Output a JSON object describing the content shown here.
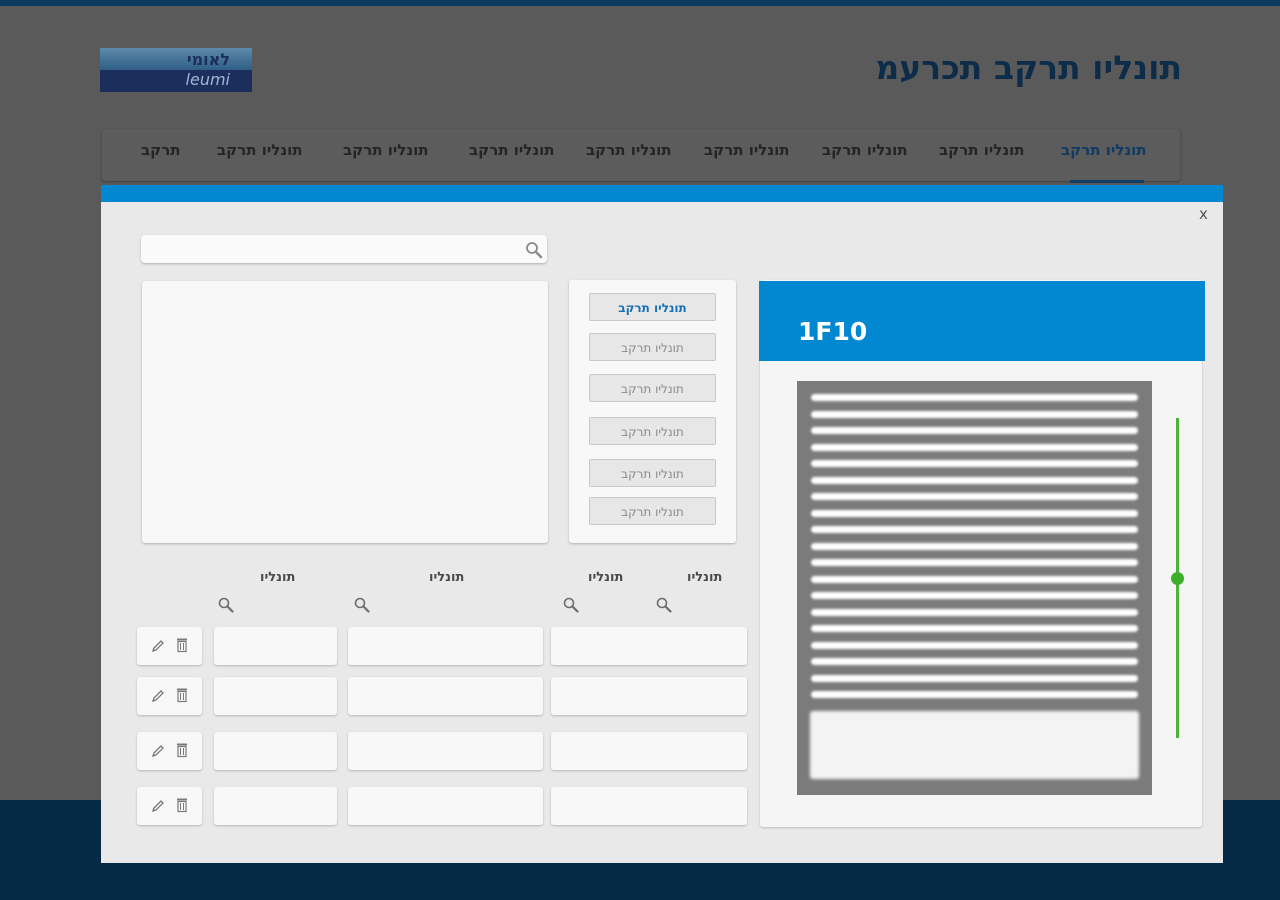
{
  "header": {
    "title": "תונליו תרקב תכרעמ",
    "logo_he": "לאומי",
    "logo_en": "leumi"
  },
  "nav": {
    "items": [
      "תונליו תרקב",
      "תונליו תרקב",
      "תונליו תרקב",
      "תונליו תרקב",
      "תונליו תרקב",
      "תונליו תרקב",
      "תונליו תרקב",
      "תונליו תרקב",
      "תרקב"
    ],
    "active_index": 0
  },
  "modal": {
    "close_label": "x",
    "search": {
      "value": "",
      "placeholder": ""
    },
    "option_buttons": [
      {
        "label": "תונליו תרקב",
        "active": true
      },
      {
        "label": "תונליו תרקב",
        "active": false
      },
      {
        "label": "תונליו תרקב",
        "active": false
      },
      {
        "label": "תונליו תרקב",
        "active": false
      },
      {
        "label": "תונליו תרקב",
        "active": false
      },
      {
        "label": "תונליו תרקב",
        "active": false
      }
    ],
    "table": {
      "headers": [
        "תונליו",
        "תונליו",
        "תונליו",
        "תונליו"
      ],
      "rows": [
        [
          "",
          "",
          ""
        ],
        [
          "",
          "",
          ""
        ],
        [
          "",
          "",
          ""
        ],
        [
          "",
          "",
          ""
        ]
      ]
    },
    "preview": {
      "code": "1F10",
      "doc_line_count": 19,
      "slider_value": 0.5
    }
  },
  "footer": {
    "left_text": "",
    "right_text": ""
  },
  "colors": {
    "accent": "#0287d1",
    "slider": "#3eae29",
    "nav_text": "#242424",
    "active_nav": "#0e3a63"
  },
  "icons": [
    "search-icon",
    "edit-icon",
    "trash-icon",
    "close-icon",
    "logo"
  ]
}
